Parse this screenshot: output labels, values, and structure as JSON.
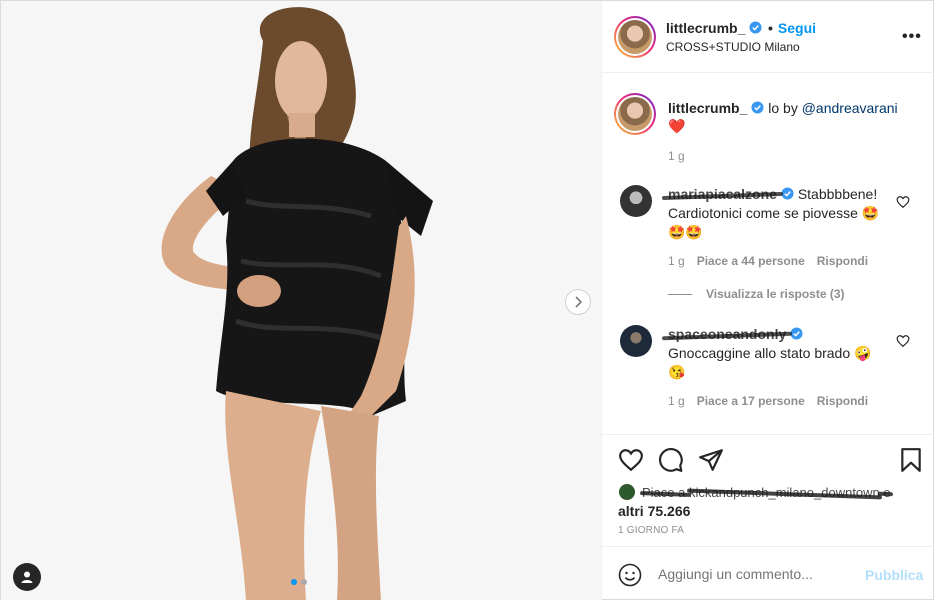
{
  "post": {
    "username": "littlecrumb_",
    "follow_sep": "•",
    "follow_label": "Segui",
    "location": "CROSS+STUDIO Milano",
    "more_label": "•••"
  },
  "caption": {
    "username": "littlecrumb_",
    "text": "lo by ",
    "mention": "@andreavarani",
    "emoji": "❤️",
    "time": "1 g"
  },
  "comments": [
    {
      "username": "mariapiacalzone",
      "text_1": "Stabbbbene!",
      "text_2": "Cardiotonici come se piovesse 🤩",
      "text_3": "🤩🤩",
      "time": "1 g",
      "likes": "Piace a 44 persone",
      "reply": "Rispondi",
      "view_replies": "Visualizza le risposte (3)"
    },
    {
      "username": "spaceoneandonly",
      "text_1": "Gnoccaggine allo stato brado 🤪",
      "text_2": "😘",
      "time": "1 g",
      "likes": "Piace a 17 persone",
      "reply": "Rispondi"
    }
  ],
  "likes": {
    "prefix": "Piace a ",
    "user": "kickandpunch_milano_downtown",
    "suffix": " e",
    "others": "altri 75.266"
  },
  "timestamp": "1 GIORNO FA",
  "add_comment": {
    "placeholder": "Aggiungi un commento...",
    "publish_label": "Pubblica"
  },
  "colors": {
    "accent": "#0095f6",
    "publish_disabled": "#b2dffc",
    "verified": "#3897f0",
    "like_heart": "#ed4956"
  },
  "icons": {
    "like": "heart-outline-icon",
    "comment": "comment-icon",
    "share": "paper-plane-icon",
    "save": "bookmark-icon",
    "emoji": "smiley-icon",
    "next": "chevron-right-icon",
    "tags": "user-tag-icon"
  }
}
